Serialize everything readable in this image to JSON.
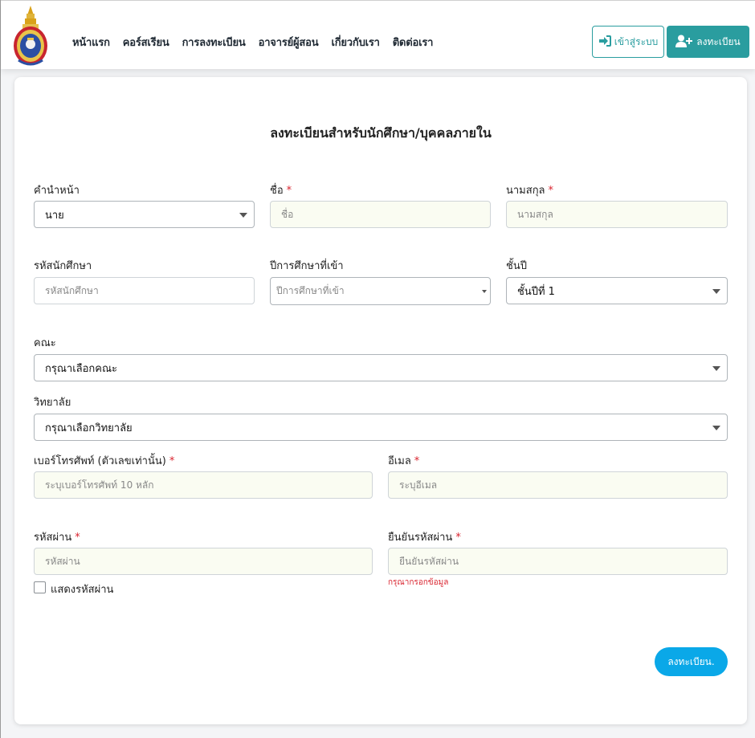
{
  "nav": {
    "links": [
      "หน้าแรก",
      "คอร์สเรียน",
      "การลงทะเบียน",
      "อาจารย์ผู้สอน",
      "เกี่ยวกับเรา",
      "ติดต่อเรา"
    ],
    "login_label": "เข้าสู่ระบบ",
    "register_label": "ลงทะเบียน"
  },
  "form": {
    "title": "ลงทะเบียนสำหรับนักศึกษา/บุคคลภายใน",
    "prefix": {
      "label": "คำนำหน้า",
      "value": "นาย"
    },
    "first_name": {
      "label": "ชื่อ",
      "required": "*",
      "placeholder": "ชื่อ"
    },
    "last_name": {
      "label": "นามสกุล",
      "required": "*",
      "placeholder": "นามสกุล"
    },
    "student_id": {
      "label": "รหัสนักศึกษา",
      "placeholder": "รหัสนักศึกษา"
    },
    "entry_year": {
      "label": "ปีการศึกษาที่เข้า",
      "placeholder": "ปีการศึกษาที่เข้า"
    },
    "year_level": {
      "label": "ชั้นปี",
      "value": "ชั้นปีที่ 1"
    },
    "faculty": {
      "label": "คณะ",
      "value": "กรุณาเลือกคณะ"
    },
    "college": {
      "label": "วิทยาลัย",
      "value": "กรุณาเลือกวิทยาลัย"
    },
    "phone": {
      "label": "เบอร์โทรศัพท์ (ตัวเลขเท่านั้น)",
      "required": "*",
      "placeholder": "ระบุเบอร์โทรศัพท์ 10 หลัก"
    },
    "email": {
      "label": "อีเมล",
      "required": "*",
      "placeholder": "ระบุอีเมล"
    },
    "password": {
      "label": "รหัสผ่าน",
      "required": "*",
      "placeholder": "รหัสผ่าน"
    },
    "confirm_password": {
      "label": "ยืนยันรหัสผ่าน",
      "required": "*",
      "placeholder": "ยืนยันรหัสผ่าน",
      "error": "กรุณากรอกข้อมูล"
    },
    "show_password_label": "แสดงรหัสผ่าน",
    "submit_label": "ลงทะเบียน."
  },
  "colors": {
    "teal": "#2a9d9f",
    "submit_blue": "#0aa8e8",
    "required_red": "#d9232e",
    "input_bg": "#fafcf2"
  },
  "icons": [
    "university-logo",
    "sign-in-icon",
    "user-plus-icon",
    "chevron-down-icon"
  ]
}
